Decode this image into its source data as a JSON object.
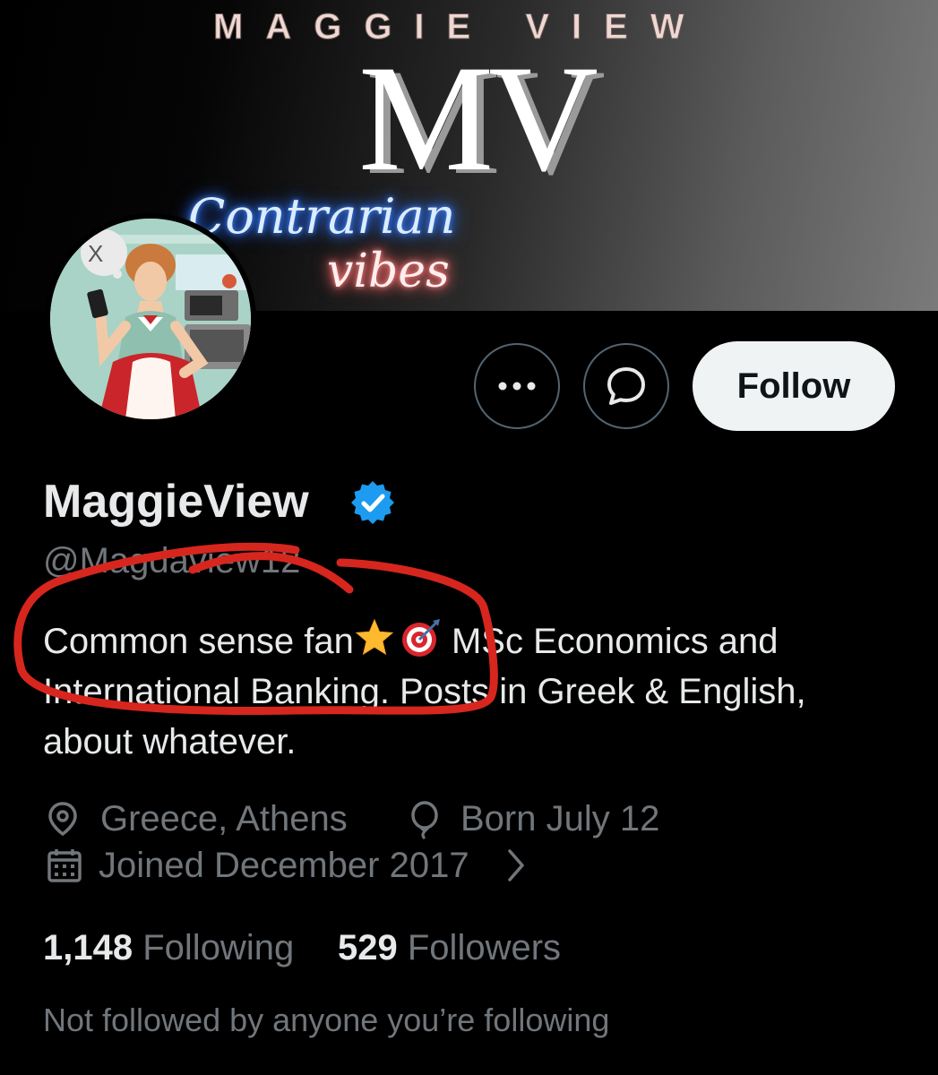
{
  "banner": {
    "brand_text": "MAGGIE VIEW",
    "monogram": "MV",
    "script_line1": "Contrarian",
    "script_line2": "vibes"
  },
  "actions": {
    "more_icon": "more-horizontal-icon",
    "message_icon": "chat-bubble-icon",
    "follow_label": "Follow"
  },
  "profile": {
    "display_name": "MaggieView",
    "verified_icon": "verified-badge-icon",
    "verified_color": "#1d9bf0",
    "handle": "@Magdaview12",
    "bio_part1": "Common sense fan",
    "bio_emoji1": "star-emoji",
    "bio_emoji2": "bullseye-emoji",
    "bio_part2": " MSc Economics and International Banking. Posts in Greek & English, about whatever."
  },
  "meta": {
    "location_icon": "location-pin-icon",
    "location": "Greece, Athens",
    "birthday_icon": "balloon-icon",
    "birthday": "Born July 12",
    "joined_icon": "calendar-icon",
    "joined": "Joined December 2017",
    "joined_chevron": "chevron-right-icon"
  },
  "stats": {
    "following_count": "1,148",
    "following_label": "Following",
    "followers_count": "529",
    "followers_label": "Followers"
  },
  "footer": {
    "note": "Not followed by anyone you’re following"
  },
  "colors": {
    "background": "#000000",
    "text_primary": "#e7e9ea",
    "text_secondary": "#71767b",
    "annotation_red": "#d7261e",
    "follow_button_bg": "#eff3f4"
  }
}
